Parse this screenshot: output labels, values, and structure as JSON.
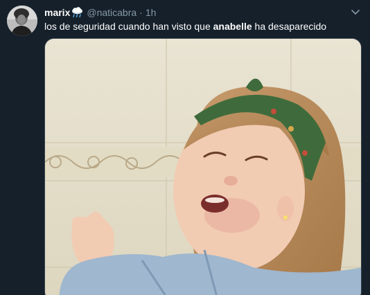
{
  "tweet": {
    "display_name": "marix",
    "name_emoji": "cloud-with-rain-icon",
    "handle": "@naticabra",
    "separator": "·",
    "time": "1h",
    "text_before": "los de seguridad cuando han visto que ",
    "text_bold": "anabelle",
    "text_after": " ha desaparecido",
    "menu_icon": "chevron-down-icon"
  },
  "colors": {
    "background": "#15202b",
    "primary_text": "#ffffff",
    "secondary_text": "#8899a6",
    "border": "#38444d"
  }
}
